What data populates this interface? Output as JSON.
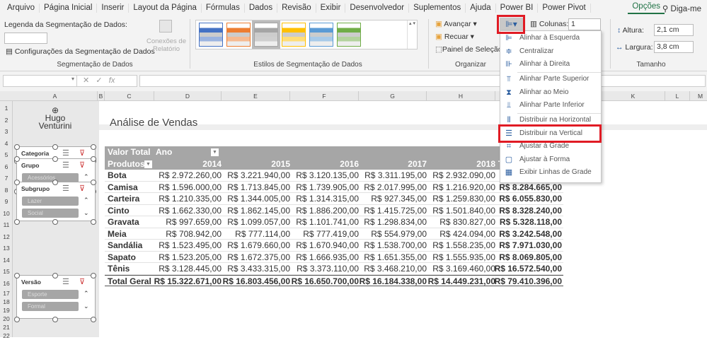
{
  "tabs": [
    "Arquivo",
    "Página Inicial",
    "Inserir",
    "Layout da Página",
    "Fórmulas",
    "Dados",
    "Revisão",
    "Exibir",
    "Desenvolvedor",
    "Suplementos",
    "Ajuda",
    "Power BI",
    "Power Pivot"
  ],
  "active_tab": "Opções",
  "tell_me": "Diga-me",
  "ribbon": {
    "caption_label": "Legenda da Segmentação de Dados:",
    "caption_value": "",
    "settings": "Configurações da Segmentação de Dados",
    "report_conn": "Conexões de Relatório",
    "group_slicer": "Segmentação de Dados",
    "group_styles": "Estilos de Segmentação de Dados",
    "styles": [
      "#4472c4",
      "#ed7d31",
      "#a5a5a5",
      "#ffc000",
      "#5b9bd5",
      "#70ad47"
    ],
    "bring_forward": "Avançar",
    "send_backward": "Recuar",
    "selection_pane": "Painel de Seleção",
    "group_arrange": "Organizar",
    "columns_label": "Colunas:",
    "columns_value": "1",
    "height_label": "Altura:",
    "height_value": "2,1 cm",
    "width_label": "Largura:",
    "width_value": "3,8 cm",
    "group_size": "Tamanho"
  },
  "formula_bar": {
    "name_box": "",
    "fx": "fx",
    "formula": ""
  },
  "columns": [
    "A",
    "B",
    "C",
    "D",
    "E",
    "F",
    "G",
    "H",
    "K",
    "L",
    "M"
  ],
  "rows": [
    "1",
    "2",
    "3",
    "4",
    "5",
    "6",
    "7",
    "8",
    "9",
    "10",
    "11",
    "12",
    "13",
    "14",
    "15",
    "16",
    "17",
    "18",
    "19",
    "20",
    "21",
    "22"
  ],
  "logo": {
    "line1": "Hugo",
    "line2": "Venturini"
  },
  "title": "Análise de Vendas",
  "slicers": [
    {
      "title": "Categoria",
      "items": []
    },
    {
      "title": "Grupo",
      "items": [
        "Acessórios"
      ]
    },
    {
      "title": "Subgrupo",
      "items": [
        "Lazer",
        "Social"
      ]
    },
    {
      "title": "Versão",
      "items": [
        "Esporte",
        "Formal"
      ]
    }
  ],
  "pivot": {
    "value_label": "Valor Total",
    "col_label": "Ano",
    "row_label": "Produtos",
    "years": [
      "2014",
      "2015",
      "2016",
      "2017",
      "2018",
      "Total Geral"
    ],
    "rows": [
      {
        "name": "Bota",
        "v": [
          "R$ 2.972.260,00",
          "R$ 3.221.940,00",
          "R$ 3.120.135,00",
          "R$ 3.311.195,00",
          "R$ 2.932.090,00",
          ""
        ]
      },
      {
        "name": "Camisa",
        "v": [
          "R$ 1.596.000,00",
          "R$ 1.713.845,00",
          "R$ 1.739.905,00",
          "R$ 2.017.995,00",
          "R$ 1.216.920,00",
          "R$ 8.284.665,00"
        ]
      },
      {
        "name": "Carteira",
        "v": [
          "R$ 1.210.335,00",
          "R$ 1.344.005,00",
          "R$ 1.314.315,00",
          "R$ 927.345,00",
          "R$ 1.259.830,00",
          "R$ 6.055.830,00"
        ]
      },
      {
        "name": "Cinto",
        "v": [
          "R$ 1.662.330,00",
          "R$ 1.862.145,00",
          "R$ 1.886.200,00",
          "R$ 1.415.725,00",
          "R$ 1.501.840,00",
          "R$ 8.328.240,00"
        ]
      },
      {
        "name": "Gravata",
        "v": [
          "R$ 997.659,00",
          "R$ 1.099.057,00",
          "R$ 1.101.741,00",
          "R$ 1.298.834,00",
          "R$ 830.827,00",
          "R$ 5.328.118,00"
        ]
      },
      {
        "name": "Meia",
        "v": [
          "R$ 708.942,00",
          "R$ 777.114,00",
          "R$ 777.419,00",
          "R$ 554.979,00",
          "R$ 424.094,00",
          "R$ 3.242.548,00"
        ]
      },
      {
        "name": "Sandália",
        "v": [
          "R$ 1.523.495,00",
          "R$ 1.679.660,00",
          "R$ 1.670.940,00",
          "R$ 1.538.700,00",
          "R$ 1.558.235,00",
          "R$ 7.971.030,00"
        ]
      },
      {
        "name": "Sapato",
        "v": [
          "R$ 1.523.205,00",
          "R$ 1.672.375,00",
          "R$ 1.666.935,00",
          "R$ 1.651.355,00",
          "R$ 1.555.935,00",
          "R$ 8.069.805,00"
        ]
      },
      {
        "name": "Tênis",
        "v": [
          "R$ 3.128.445,00",
          "R$ 3.433.315,00",
          "R$ 3.373.110,00",
          "R$ 3.468.210,00",
          "R$ 3.169.460,00",
          "R$ 16.572.540,00"
        ]
      }
    ],
    "total": {
      "name": "Total Geral",
      "v": [
        "R$ 15.322.671,00",
        "R$ 16.803.456,00",
        "R$ 16.650.700,00",
        "R$ 16.184.338,00",
        "R$ 14.449.231,00",
        "R$ 79.410.396,00"
      ]
    }
  },
  "align_menu": [
    {
      "label": "Alinhar à Esquerda",
      "icon": "align-left-icon",
      "glyph": "⊫"
    },
    {
      "label": "Centralizar",
      "icon": "align-center-icon",
      "glyph": "≑"
    },
    {
      "label": "Alinhar à Direita",
      "icon": "align-right-icon",
      "glyph": "⊪"
    },
    {
      "label": "Alinhar Parte Superior",
      "icon": "align-top-icon",
      "glyph": "⫪"
    },
    {
      "label": "Alinhar ao Meio",
      "icon": "align-middle-icon",
      "glyph": "⧗"
    },
    {
      "label": "Alinhar Parte Inferior",
      "icon": "align-bottom-icon",
      "glyph": "⫫"
    },
    {
      "label": "Distribuir na Horizontal",
      "icon": "distribute-horizontal-icon",
      "glyph": "⫴"
    },
    {
      "label": "Distribuir na Vertical",
      "icon": "distribute-vertical-icon",
      "glyph": "☰"
    },
    {
      "label": "Ajustar à Grade",
      "icon": "snap-grid-icon",
      "glyph": "⌗"
    },
    {
      "label": "Ajustar à Forma",
      "icon": "snap-shape-icon",
      "glyph": "▢"
    },
    {
      "label": "Exibir Linhas de Grade",
      "icon": "gridlines-icon",
      "glyph": "▦"
    }
  ]
}
